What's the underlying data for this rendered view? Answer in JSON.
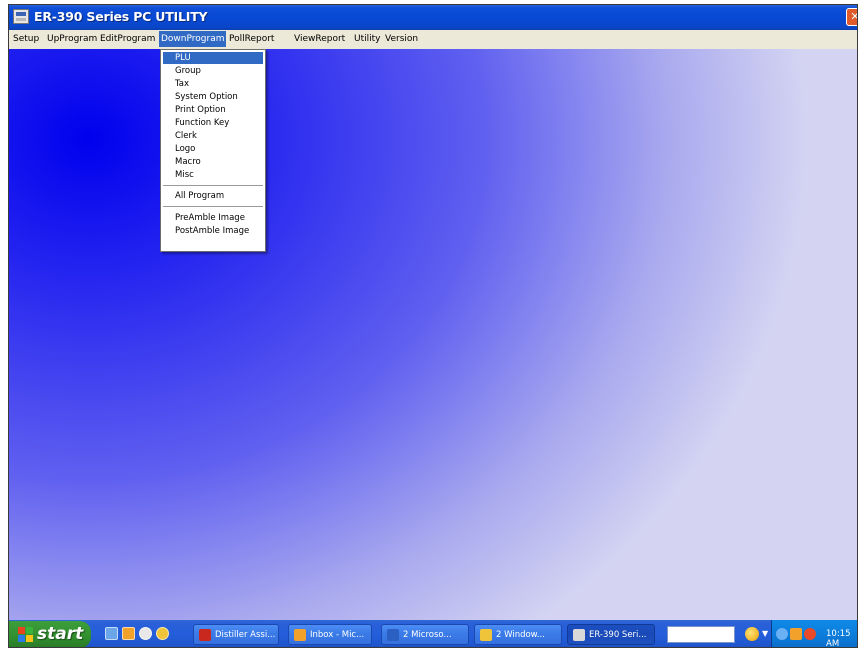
{
  "window": {
    "title": "ER-390 Series PC UTILITY",
    "close_glyph": "✕"
  },
  "menubar": {
    "items": [
      "Setup",
      "UpProgram",
      "EditProgram",
      "DownProgram",
      "PollReport",
      "ViewReport",
      "Utility",
      "Version"
    ],
    "active": "DownProgram"
  },
  "dropdown": {
    "group1": [
      "PLU",
      "Group",
      "Tax",
      "System Option",
      "Print Option",
      "Function Key",
      "Clerk",
      "Logo",
      "Macro",
      "Misc"
    ],
    "group2": [
      "All Program"
    ],
    "group3": [
      "PreAmble Image",
      "PostAmble Image"
    ],
    "highlighted": "PLU"
  },
  "taskbar": {
    "start_label": "start",
    "buttons": [
      {
        "label": "Distiller Assi...",
        "icon": "adobe-distiller-icon",
        "icon_color": "#c8281e"
      },
      {
        "label": "Inbox - Mic...",
        "icon": "outlook-icon",
        "icon_color": "#f2a22a"
      },
      {
        "label": "2 Microso...",
        "icon": "word-icon",
        "icon_color": "#2b5fc2"
      },
      {
        "label": "2 Window...",
        "icon": "folder-icon",
        "icon_color": "#f0c43a"
      },
      {
        "label": "ER-390 Seri...",
        "icon": "app-icon",
        "icon_color": "#d8d8d8"
      }
    ],
    "clock": "10:15 AM"
  },
  "colors": {
    "title_bar": "#0748d4",
    "menu_highlight": "#316ac5",
    "taskbar": "#245edb",
    "start_button": "#3a9a38",
    "tray": "#0c7ddb"
  }
}
